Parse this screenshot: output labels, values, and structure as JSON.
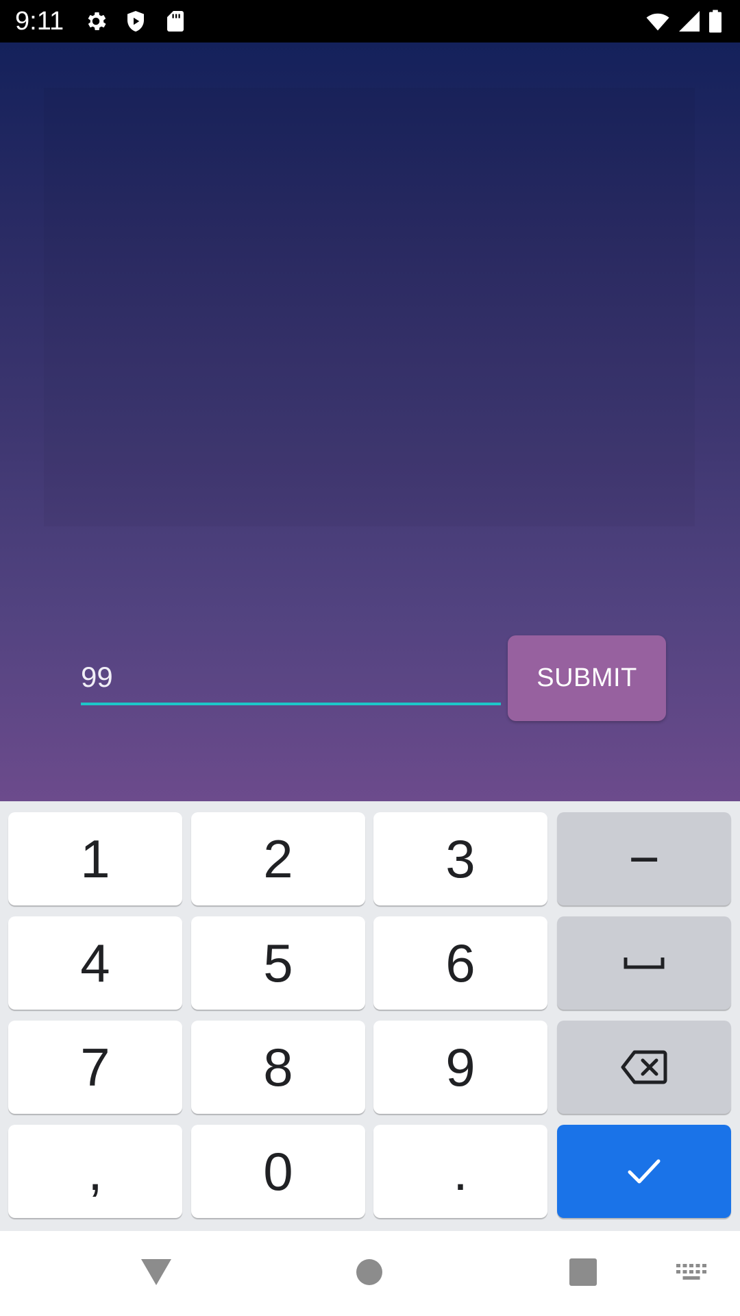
{
  "status_bar": {
    "time": "9:11",
    "icons": [
      "settings-icon",
      "shield-icon",
      "sd-card-icon",
      "wifi-icon",
      "signal-icon",
      "battery-icon"
    ]
  },
  "form": {
    "input_value": "99",
    "submit_label": "SUBMIT"
  },
  "keyboard": {
    "keys": [
      "1",
      "2",
      "3",
      "−",
      "4",
      "5",
      "6",
      "7",
      "8",
      "9",
      ",",
      "0",
      "."
    ],
    "icons": [
      "space-icon",
      "backspace-icon",
      "checkmark-icon"
    ]
  },
  "navigation": {
    "icons": [
      "back-icon",
      "home-icon",
      "recents-icon",
      "keyboard-icon"
    ]
  },
  "colors": {
    "status_bar": "#000000",
    "gradient_top": "#14215b",
    "gradient_bottom": "#6c4b8c",
    "input_underline": "#1dc6c9",
    "submit_button": "#97619f",
    "keyboard_bg": "#e8eaed",
    "function_key": "#cbcdd3",
    "enter_key": "#1a73e8"
  }
}
